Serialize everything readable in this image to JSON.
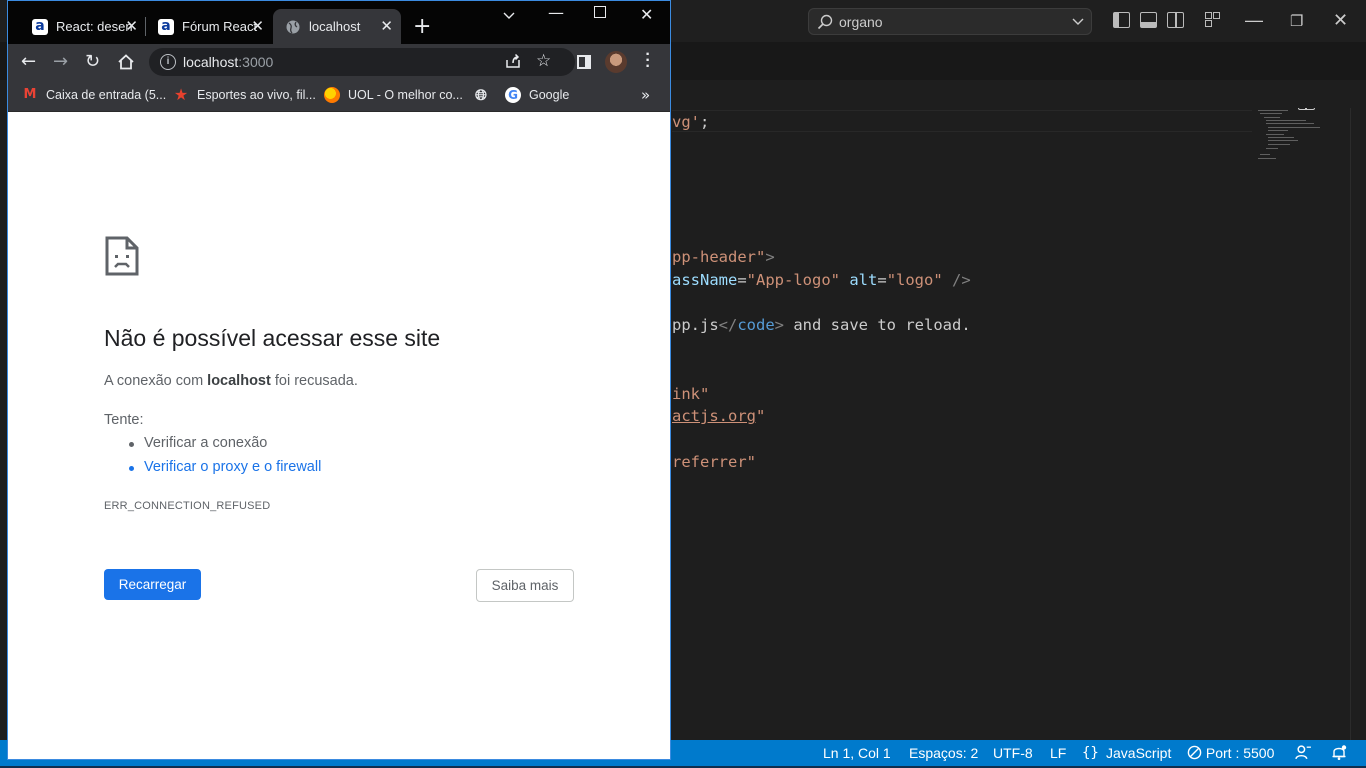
{
  "vscode": {
    "command_center": {
      "label": "organo"
    },
    "code_lines": [
      {
        "parts": [
          {
            "t": "vg'",
            "c": "str"
          },
          {
            "t": ";",
            "c": ""
          }
        ]
      },
      {
        "parts": [
          {
            "t": "pp-header\"",
            "c": "str"
          },
          {
            "t": ">",
            "c": "punc"
          }
        ]
      },
      {
        "parts": [
          {
            "t": "assName",
            "c": "attr"
          },
          {
            "t": "=",
            "c": ""
          },
          {
            "t": "\"App-logo\"",
            "c": "str"
          },
          {
            "t": " ",
            "c": ""
          },
          {
            "t": "alt",
            "c": "attr"
          },
          {
            "t": "=",
            "c": ""
          },
          {
            "t": "\"logo\"",
            "c": "str"
          },
          {
            "t": " />",
            "c": "punc"
          }
        ]
      },
      {
        "parts": [
          {
            "t": "pp.js",
            "c": ""
          },
          {
            "t": "</",
            "c": "punc"
          },
          {
            "t": "code",
            "c": "tag"
          },
          {
            "t": ">",
            "c": "punc"
          },
          {
            "t": " and save to reload.",
            "c": ""
          }
        ]
      },
      {
        "parts": [
          {
            "t": "ink\"",
            "c": "str"
          }
        ]
      },
      {
        "parts": [
          {
            "t": "actjs.org",
            "c": "str link"
          },
          {
            "t": "\"",
            "c": "str"
          }
        ]
      },
      {
        "parts": [
          {
            "t": "referrer\"",
            "c": "str"
          }
        ]
      }
    ],
    "statusbar": {
      "position": "Ln 1, Col 1",
      "indent": "Espaços: 2",
      "encoding": "UTF-8",
      "eol": "LF",
      "language": "JavaScript",
      "port": "Port : 5500"
    },
    "colors": {
      "accent": "#007acc",
      "background": "#1e1e1e"
    }
  },
  "chrome": {
    "tabs": [
      {
        "title": "React: desen",
        "favicon": "alura-icon"
      },
      {
        "title": "Fórum React",
        "favicon": "alura-icon"
      },
      {
        "title": "localhost",
        "favicon": "globe-icon",
        "active": true
      }
    ],
    "omnibox": {
      "host": "localhost",
      "port": ":3000"
    },
    "bookmarks": [
      {
        "label": "Caixa de entrada (5...",
        "icon": "gmail-icon"
      },
      {
        "label": "Esportes ao vivo, fil...",
        "icon": "star-icon"
      },
      {
        "label": "UOL - O melhor co...",
        "icon": "uol-icon"
      },
      {
        "label": "",
        "icon": "globe-icon"
      },
      {
        "label": "Google",
        "icon": "google-icon"
      }
    ]
  },
  "error_page": {
    "title": "Não é possível acessar esse site",
    "desc_pre": "A conexão com ",
    "desc_host": "localhost",
    "desc_post": " foi recusada.",
    "try_label": "Tente:",
    "suggestions": [
      {
        "text": "Verificar a conexão",
        "link": false
      },
      {
        "text": "Verificar o proxy e o firewall",
        "link": true
      }
    ],
    "error_code": "ERR_CONNECTION_REFUSED",
    "reload_button": "Recarregar",
    "details_button": "Saiba mais",
    "colors": {
      "primary": "#1a73e8",
      "text": "#202124",
      "muted": "#5f6368"
    }
  }
}
